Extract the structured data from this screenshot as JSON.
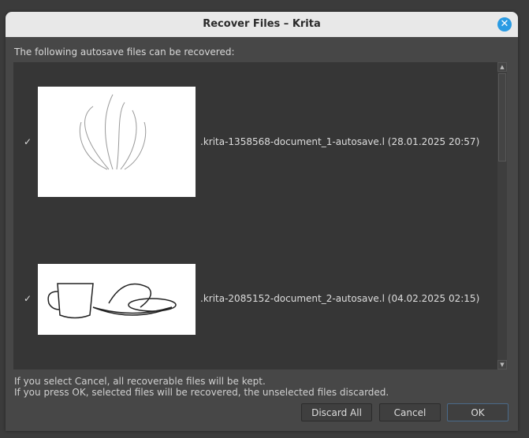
{
  "window": {
    "title": "Recover Files – Krita"
  },
  "prompt": "The following autosave files can be recovered:",
  "files": [
    {
      "checked": "✓",
      "name": ".krita-1358568-document_1-autosave.l",
      "date": "(28.01.2025 20:57)"
    },
    {
      "checked": "✓",
      "name": ".krita-2085152-document_2-autosave.l",
      "date": "(04.02.2025 02:15)"
    }
  ],
  "info": [
    "If you select Cancel, all recoverable files will be kept.",
    "If you press OK, selected files will be recovered, the unselected files discarded."
  ],
  "buttons": {
    "discard_all": "Discard All",
    "cancel": "Cancel",
    "ok": "OK"
  }
}
